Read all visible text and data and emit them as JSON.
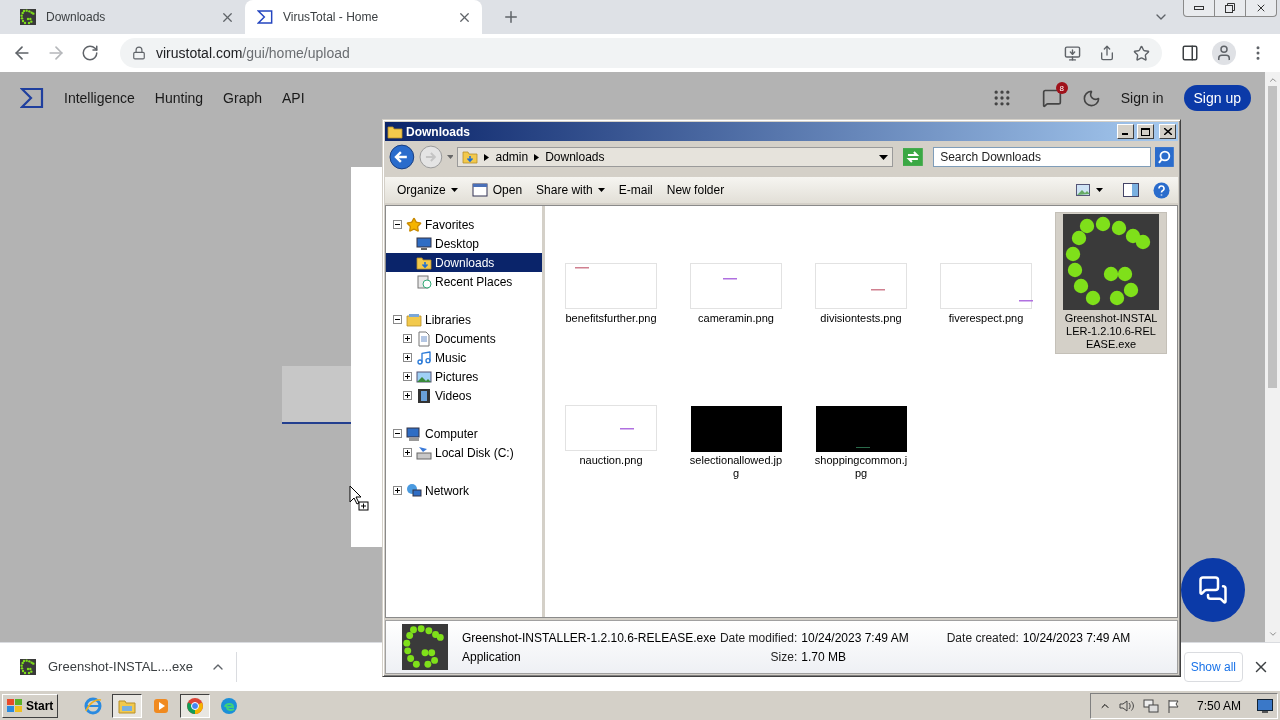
{
  "browser": {
    "tabs": [
      {
        "title": "Downloads",
        "kind": "app",
        "selected": false
      },
      {
        "title": "VirusTotal - Home",
        "kind": "site",
        "selected": true
      }
    ],
    "url": "virustotal.com/gui/home/upload"
  },
  "site": {
    "nav": [
      "Intelligence",
      "Hunting",
      "Graph",
      "API"
    ],
    "notification_count": "8",
    "sign_in": "Sign in",
    "sign_up": "Sign up"
  },
  "explorer": {
    "title": "Downloads",
    "breadcrumb": [
      "admin",
      "Downloads"
    ],
    "search": {
      "placeholder": "Search Downloads"
    },
    "toolbar": [
      {
        "label": "Organize",
        "kind": "menu"
      },
      {
        "label": "Open",
        "kind": "open"
      },
      {
        "label": "Share with",
        "kind": "menu"
      },
      {
        "label": "E-mail",
        "kind": "plain"
      },
      {
        "label": "New folder",
        "kind": "plain"
      }
    ],
    "tree": [
      {
        "label": "Favorites",
        "kind": "star",
        "expanded": true,
        "selected": false,
        "children": [
          {
            "label": "Desktop",
            "kind": "desktop",
            "selected": false
          },
          {
            "label": "Downloads",
            "kind": "downloads",
            "selected": true
          },
          {
            "label": "Recent Places",
            "kind": "recent",
            "selected": false
          }
        ]
      },
      {
        "label": "Libraries",
        "kind": "libraries",
        "expanded": true,
        "selected": false,
        "children": [
          {
            "label": "Documents",
            "kind": "documents",
            "expanded": false,
            "selected": false
          },
          {
            "label": "Music",
            "kind": "music",
            "expanded": false,
            "selected": false
          },
          {
            "label": "Pictures",
            "kind": "pictures",
            "expanded": false,
            "selected": false
          },
          {
            "label": "Videos",
            "kind": "videos",
            "expanded": false,
            "selected": false
          }
        ]
      },
      {
        "label": "Computer",
        "kind": "computer",
        "expanded": true,
        "selected": false,
        "children": [
          {
            "label": "Local Disk (C:)",
            "kind": "disk",
            "expanded": false,
            "selected": false
          }
        ]
      },
      {
        "label": "Network",
        "kind": "network",
        "expanded": false,
        "selected": false
      }
    ],
    "files": [
      {
        "name": "benefitsfurther.png",
        "kind": "light",
        "selected": false
      },
      {
        "name": "cameramin.png",
        "kind": "light",
        "selected": false
      },
      {
        "name": "divisiontests.png",
        "kind": "light",
        "selected": false
      },
      {
        "name": "fiverespect.png",
        "kind": "light",
        "selected": false
      },
      {
        "name": "Greenshot-INSTALLER-1.2.10.6-RELEASE.exe",
        "kind": "app",
        "selected": true
      },
      {
        "name": "nauction.png",
        "kind": "light",
        "selected": false
      },
      {
        "name": "selectionallowed.jpg",
        "kind": "dark",
        "selected": false
      },
      {
        "name": "shoppingcommon.jpg",
        "kind": "dark",
        "selected": false
      }
    ],
    "details": {
      "name": "Greenshot-INSTALLER-1.2.10.6-RELEASE.exe",
      "type": "Application",
      "rows": [
        [
          {
            "label": "Date modified:",
            "value": "10/24/2023 7:49 AM"
          },
          {
            "label": "Date created:",
            "value": "10/24/2023 7:49 AM"
          }
        ],
        [
          {
            "label": "Size:",
            "value": "1.70 MB"
          }
        ]
      ]
    }
  },
  "downloads_bar": {
    "file": "Greenshot-INSTAL....exe",
    "show_all": "Show all"
  },
  "taskbar": {
    "start": "Start",
    "apps": [
      {
        "kind": "ie",
        "pressed": false
      },
      {
        "kind": "explorer",
        "pressed": true
      },
      {
        "kind": "media",
        "pressed": false
      },
      {
        "kind": "chrome",
        "pressed": true
      },
      {
        "kind": "edge",
        "pressed": false
      }
    ],
    "clock": "7:50 AM"
  }
}
